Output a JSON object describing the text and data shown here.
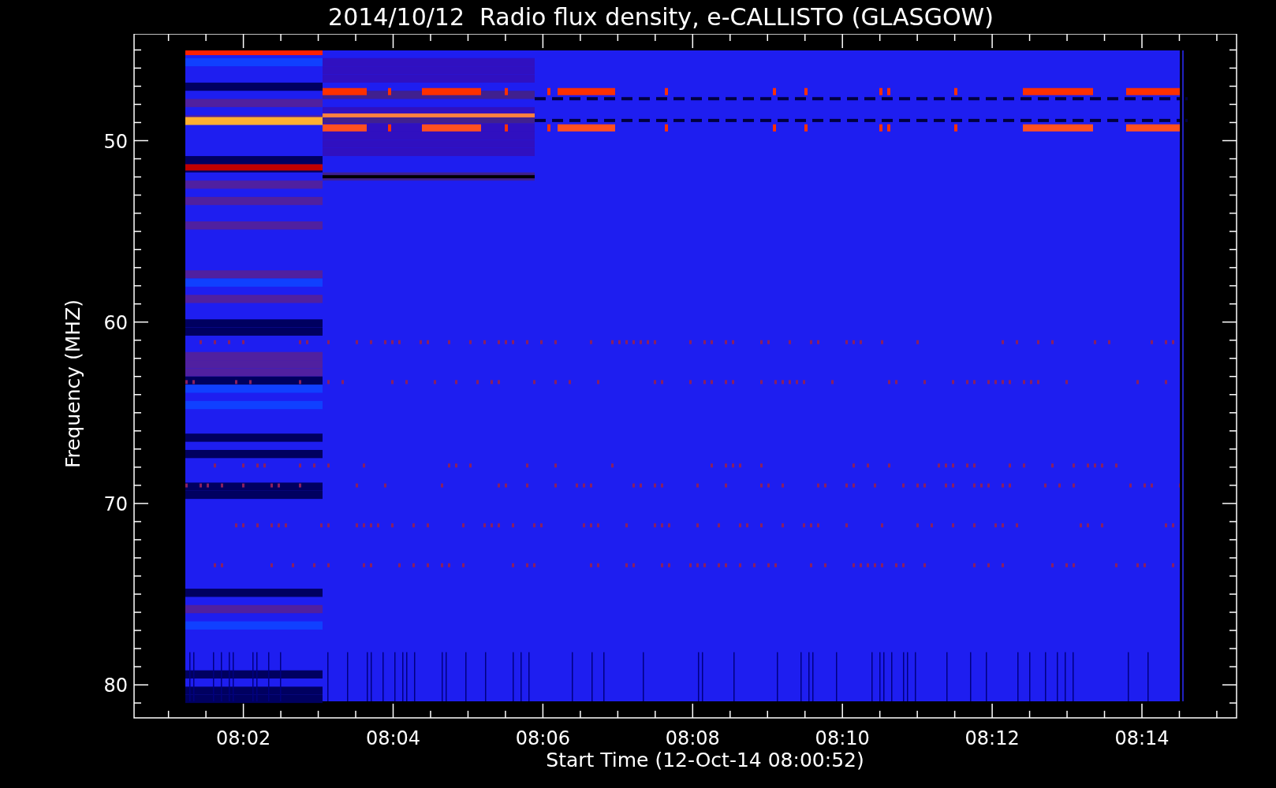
{
  "title": "2014/10/12  Radio flux density, e-CALLISTO (GLASGOW)",
  "y_axis": {
    "label": "Frequency (MHZ)",
    "ticks": [
      "50",
      "60",
      "70",
      "80"
    ]
  },
  "x_axis": {
    "label": "Start Time (12-Oct-14 08:00:52)",
    "ticks": [
      "08:02",
      "08:04",
      "08:06",
      "08:08",
      "08:10",
      "08:12",
      "08:14"
    ]
  }
}
